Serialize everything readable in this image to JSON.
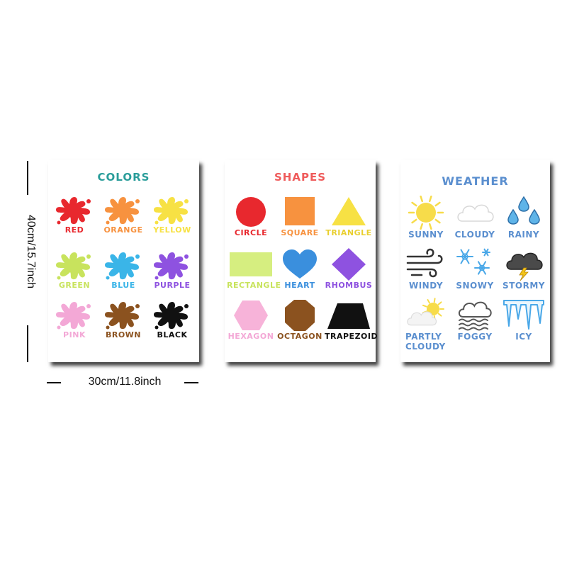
{
  "posters": [
    {
      "title": "COLORS",
      "title_color": "#2a9d9a",
      "items": [
        {
          "label": "RED",
          "color": "#e8282e",
          "icon": "splat-icon"
        },
        {
          "label": "ORANGE",
          "color": "#f7923f",
          "icon": "splat-icon"
        },
        {
          "label": "YELLOW",
          "color": "#f7e144",
          "icon": "splat-icon"
        },
        {
          "label": "GREEN",
          "color": "#c8e35d",
          "icon": "splat-icon"
        },
        {
          "label": "BLUE",
          "color": "#3ab5e8",
          "icon": "splat-icon"
        },
        {
          "label": "PURPLE",
          "color": "#8e52e0",
          "icon": "splat-icon"
        },
        {
          "label": "PINK",
          "color": "#f3a8d6",
          "icon": "splat-icon"
        },
        {
          "label": "BROWN",
          "color": "#8b521f",
          "icon": "splat-icon"
        },
        {
          "label": "BLACK",
          "color": "#111111",
          "icon": "splat-icon"
        }
      ]
    },
    {
      "title": "SHAPES",
      "title_color": "#ef5b5b",
      "items": [
        {
          "label": "CIRCLE",
          "color": "#e8282e",
          "label_color": "#e8282e",
          "icon": "circle-icon"
        },
        {
          "label": "SQUARE",
          "color": "#f7923f",
          "label_color": "#f7923f",
          "icon": "square-icon"
        },
        {
          "label": "TRIANGLE",
          "color": "#f7e144",
          "label_color": "#e9cf2f",
          "icon": "triangle-icon"
        },
        {
          "label": "RECTANGLE",
          "color": "#d6ee80",
          "label_color": "#c8e35d",
          "icon": "rectangle-icon"
        },
        {
          "label": "HEART",
          "color": "#3a8fdd",
          "label_color": "#3a8fdd",
          "icon": "heart-icon"
        },
        {
          "label": "RHOMBUS",
          "color": "#8e52e0",
          "label_color": "#8e52e0",
          "icon": "rhombus-icon"
        },
        {
          "label": "HEXAGON",
          "color": "#f7b3d9",
          "label_color": "#f3a8d6",
          "icon": "hexagon-icon"
        },
        {
          "label": "OCTAGON",
          "color": "#8b521f",
          "label_color": "#8b521f",
          "icon": "octagon-icon"
        },
        {
          "label": "TRAPEZOID",
          "color": "#111111",
          "label_color": "#111111",
          "icon": "trapezoid-icon"
        }
      ]
    },
    {
      "title": "WEATHER",
      "title_color": "#5b8fcf",
      "label_color": "#5b8fcf",
      "items": [
        {
          "label": "SUNNY",
          "icon": "sun-icon"
        },
        {
          "label": "CLOUDY",
          "icon": "cloud-icon"
        },
        {
          "label": "RAINY",
          "icon": "raindrops-icon"
        },
        {
          "label": "WINDY",
          "icon": "wind-icon"
        },
        {
          "label": "SNOWY",
          "icon": "snowflake-icon"
        },
        {
          "label": "STORMY",
          "icon": "storm-cloud-icon"
        },
        {
          "label": "PARTLY\nCLOUDY",
          "icon": "partly-cloudy-icon"
        },
        {
          "label": "FOGGY",
          "icon": "fog-icon"
        },
        {
          "label": "ICY",
          "icon": "icicles-icon"
        }
      ]
    }
  ],
  "dimensions": {
    "height_label": "40cm/15.7inch",
    "width_label": "30cm/11.8inch"
  }
}
